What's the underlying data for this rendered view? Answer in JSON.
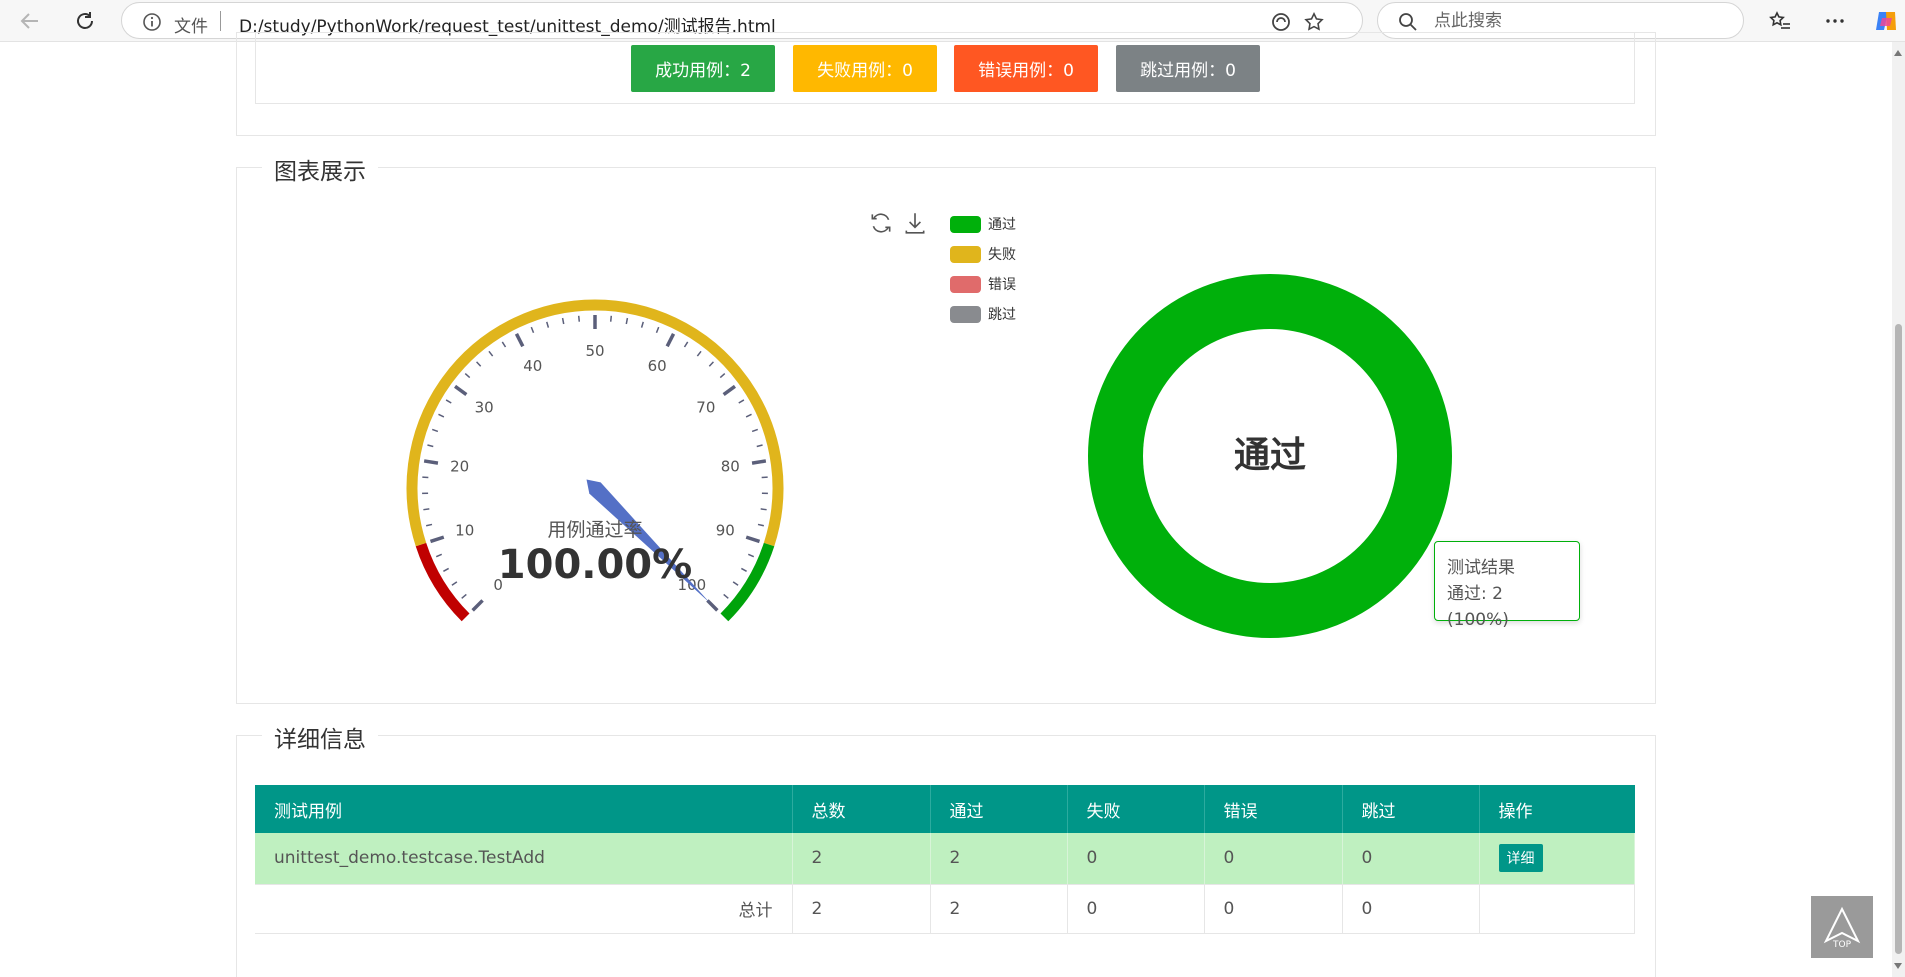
{
  "browser": {
    "file_label": "文件",
    "url": "D:/study/PythonWork/request_test/unittest_demo/测试报告.html",
    "search_placeholder": "点此搜索"
  },
  "stats": {
    "success": "成功用例：2",
    "fail": "失败用例：0",
    "error": "错误用例：0",
    "skip": "跳过用例：0"
  },
  "charts_section": {
    "title": "图表展示"
  },
  "gauge": {
    "label": "用例通过率",
    "value_text": "100.00%",
    "value": 100,
    "ticks": [
      "0",
      "10",
      "20",
      "30",
      "40",
      "50",
      "60",
      "70",
      "80",
      "90",
      "100"
    ]
  },
  "legend": [
    "通过",
    "失败",
    "错误",
    "跳过"
  ],
  "colors": {
    "pass": "#00b00b",
    "fail": "#e0b51c",
    "error": "#e06b6b",
    "skip": "#898b8f",
    "teal": "#009688"
  },
  "donut": {
    "center_label": "通过"
  },
  "tooltip": {
    "title": "测试结果",
    "line": "通过: 2 (100%)"
  },
  "chart_data": [
    {
      "type": "gauge",
      "title": "用例通过率",
      "value": 100,
      "range": [
        0,
        100
      ]
    },
    {
      "type": "pie",
      "categories": [
        "通过",
        "失败",
        "错误",
        "跳过"
      ],
      "values": [
        2,
        0,
        0,
        0
      ]
    }
  ],
  "details": {
    "title": "详细信息",
    "headers": [
      "测试用例",
      "总数",
      "通过",
      "失败",
      "错误",
      "跳过",
      "操作"
    ],
    "row": {
      "name": "unittest_demo.testcase.TestAdd",
      "total": "2",
      "pass": "2",
      "fail": "0",
      "error": "0",
      "skip": "0",
      "action": "详细"
    },
    "total_row": {
      "label": "总计",
      "total": "2",
      "pass": "2",
      "fail": "0",
      "error": "0",
      "skip": "0"
    }
  },
  "top_button": "TOP"
}
